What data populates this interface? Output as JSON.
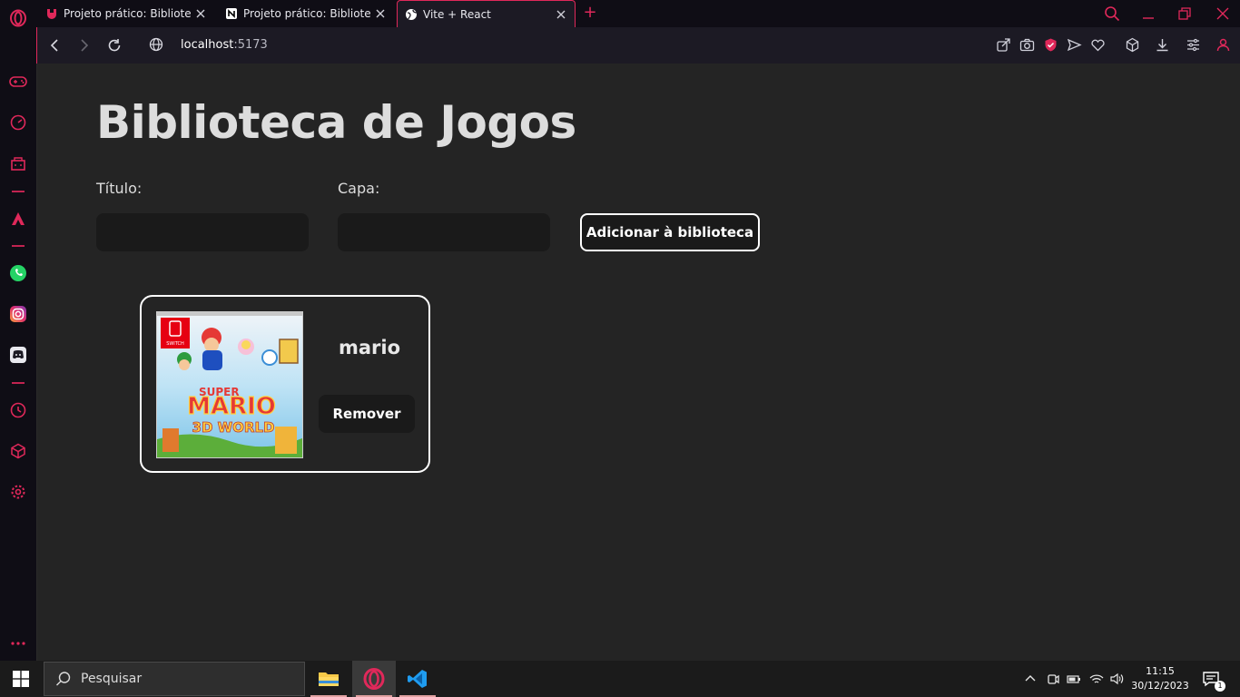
{
  "browser": {
    "tabs": [
      {
        "title": "Projeto prático: Biblioteca de",
        "icon": "gitlab-like-shield-icon",
        "active": false
      },
      {
        "title": "Projeto prático: Biblioteca de",
        "icon": "notion-icon",
        "active": false
      },
      {
        "title": "Vite + React",
        "icon": "globe-icon",
        "active": true
      }
    ],
    "new_tab": "+",
    "url_host": "localhost",
    "url_port": ":5173",
    "accent": "#e0285a"
  },
  "page": {
    "heading": "Biblioteca de Jogos",
    "form": {
      "title_label": "Título:",
      "cover_label": "Capa:",
      "title_value": "",
      "cover_value": "",
      "add_button": "Adicionar à biblioteca"
    },
    "games": [
      {
        "title": "mario",
        "cover_alt": "SUPER MARIO 3D WORLD",
        "remove_button": "Remover",
        "cover_logo_super": "SUPER",
        "cover_logo_main": "MARIO",
        "cover_logo_sub": "3D WORLD",
        "cover_console": "SWITCH"
      }
    ]
  },
  "taskbar": {
    "search_placeholder": "Pesquisar",
    "time": "11:15",
    "date": "30/12/2023",
    "notifications": "1"
  }
}
